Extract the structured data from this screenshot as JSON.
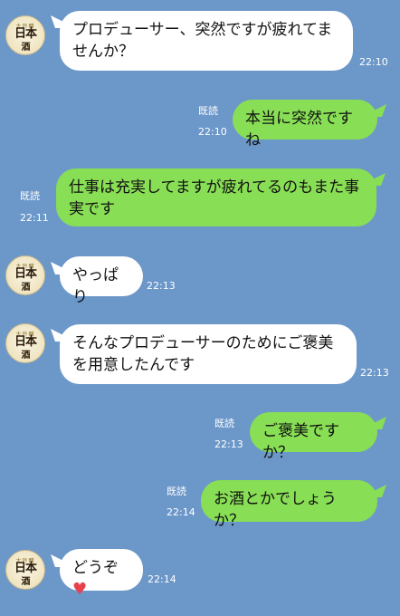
{
  "contact": {
    "avatar_icon": "nihonshu-sake-label-avatar",
    "avatar_top": "大吟醸",
    "avatar_main": "日本",
    "avatar_sub": "酒"
  },
  "messages": [
    {
      "dir": "in",
      "text": "プロデューサー、突然ですが疲れてませんか？",
      "line1": "プロデューサー、突然ですが疲れてま",
      "line2": "せんか？",
      "time": "22:10"
    },
    {
      "dir": "out",
      "text": "本当に突然ですね",
      "read": "既読",
      "time": "22:10"
    },
    {
      "dir": "out",
      "text": "仕事は充実してますが疲れてるのもまた事実です",
      "line1": "仕事は充実してますが疲れてるのもまた事",
      "line2": "実です",
      "read": "既読",
      "time": "22:11"
    },
    {
      "dir": "in",
      "text": "やっぱり",
      "time": "22:13"
    },
    {
      "dir": "in",
      "text": "そんなプロデューサーのためにご褒美を用意したんです",
      "line1": "そんなプロデューサーのためにご褒美",
      "line2": "を用意したんです",
      "time": "22:13"
    },
    {
      "dir": "out",
      "text": "ご褒美ですか？",
      "read": "既読",
      "time": "22:13"
    },
    {
      "dir": "out",
      "text": "お酒とかでしょうか？",
      "read": "既読",
      "time": "22:14"
    },
    {
      "dir": "in",
      "text": "どうぞ",
      "emoji": "♥",
      "time": "22:14"
    }
  ],
  "colors": {
    "background": "#6c97c9",
    "incoming": "#ffffff",
    "outgoing": "#88de55",
    "heart": "#e8414b"
  }
}
